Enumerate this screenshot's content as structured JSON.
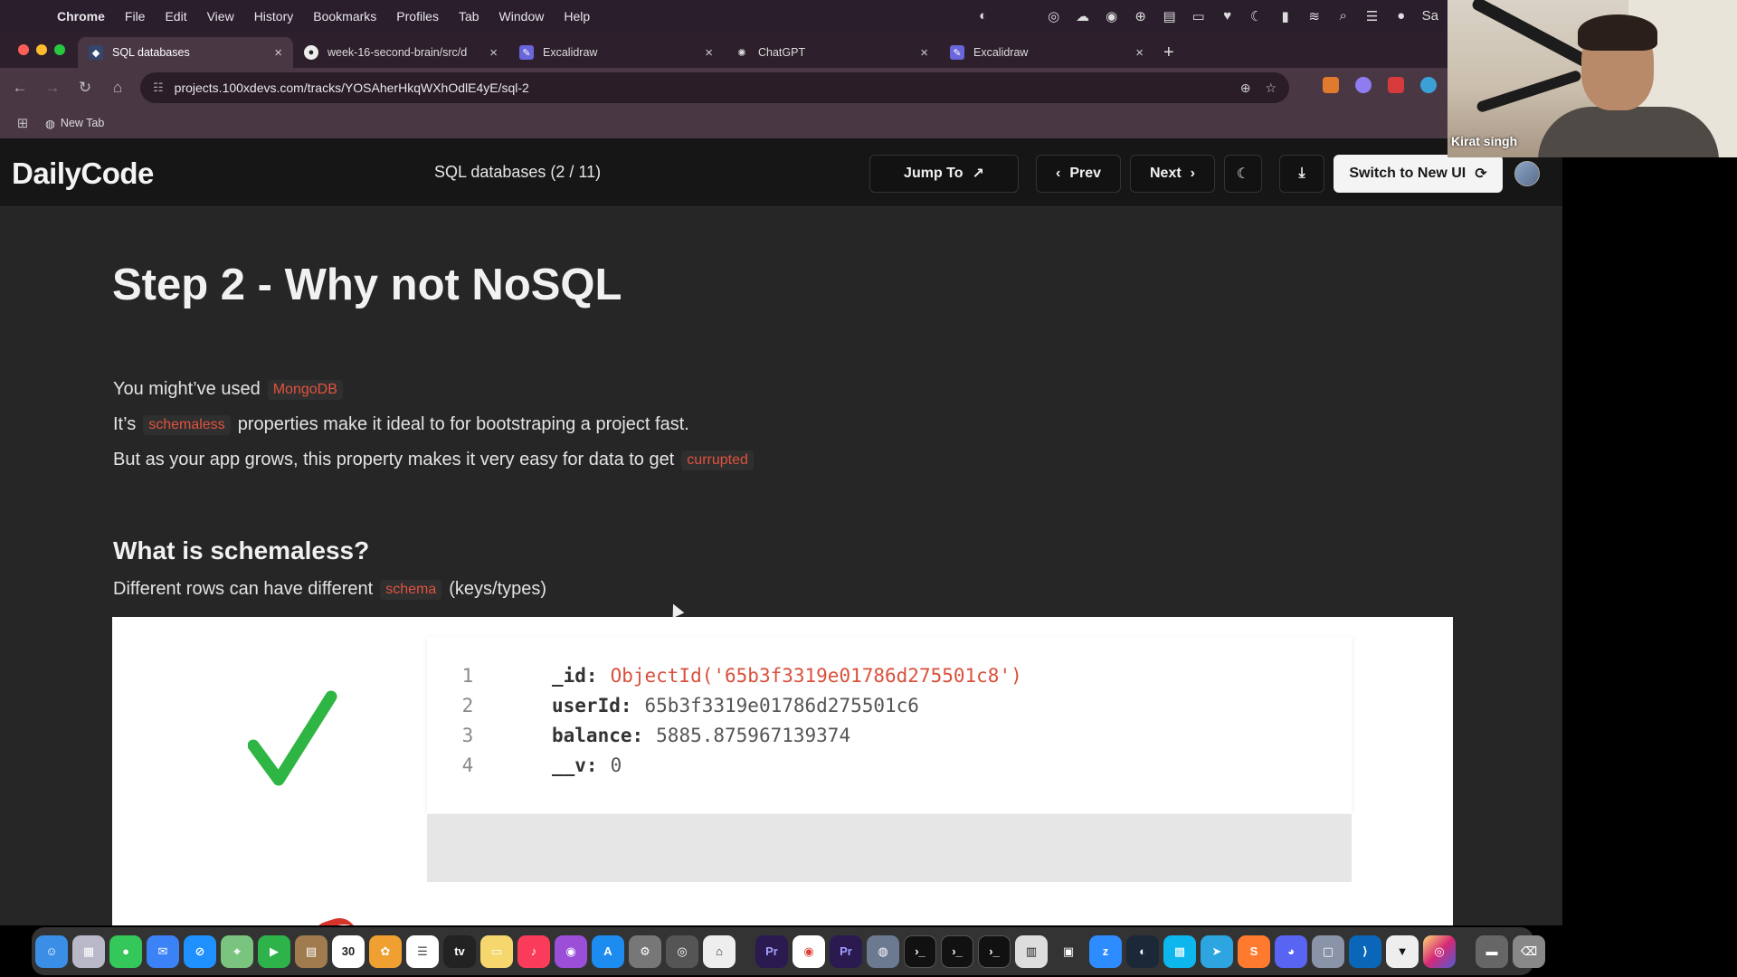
{
  "menubar": {
    "app_name": "Chrome",
    "items": [
      "File",
      "Edit",
      "View",
      "History",
      "Bookmarks",
      "Profiles",
      "Tab",
      "Window",
      "Help"
    ],
    "status_icons": [
      "sync-icon",
      "vpn-icon",
      "cloud-icon",
      "network-icon",
      "globe-icon",
      "clipboard-icon",
      "battery-sensor-icon",
      "heart-icon",
      "moon-icon",
      "battery-icon",
      "wifi-icon",
      "search-icon",
      "control-center-icon",
      "siri-icon"
    ],
    "trailing_text": "Sa"
  },
  "browser": {
    "tabs": [
      {
        "title": "SQL databases",
        "active": true,
        "favicon": "100x-icon"
      },
      {
        "title": "week-16-second-brain/src/d",
        "active": false,
        "favicon": "github-icon"
      },
      {
        "title": "Excalidraw",
        "active": false,
        "favicon": "excalidraw-icon"
      },
      {
        "title": "ChatGPT",
        "active": false,
        "favicon": "chatgpt-icon"
      },
      {
        "title": "Excalidraw",
        "active": false,
        "favicon": "excalidraw-icon"
      }
    ],
    "url": "projects.100xdevs.com/tracks/YOSAherHkqWXhOdlE4yE/sql-2",
    "bookmark": "New Tab"
  },
  "app": {
    "logo": "DailyCode",
    "course_title": "SQL databases (2 / 11)",
    "jump_to": "Jump To",
    "prev": "Prev",
    "next": "Next",
    "switch_ui": "Switch to New UI"
  },
  "content": {
    "heading": "Step 2 - Why not NoSQL",
    "line1_text": "You might’ve used",
    "line1_code": "MongoDB",
    "line2_pre": "It’s",
    "line2_code": "schemaless",
    "line2_post": "properties make it ideal to for bootstraping a project fast.",
    "line3_text": "But as your app grows, this property makes it very easy for data to get",
    "line3_code": "currupted",
    "subheading": "What is schemaless?",
    "line4_pre": "Different rows can have different",
    "line4_code": "schema",
    "line4_post": "(keys/types)"
  },
  "code_sample": {
    "lines": [
      {
        "n": "1",
        "key": "_id:",
        "value": "ObjectId('65b3f3319e01786d275501c8')"
      },
      {
        "n": "2",
        "key": "userId:",
        "value": "65b3f3319e01786d275501c6"
      },
      {
        "n": "3",
        "key": "balance:",
        "value": "5885.875967139374"
      },
      {
        "n": "4",
        "key": "__v:",
        "value": "0"
      }
    ]
  },
  "webcam": {
    "name": "Kirat singh"
  },
  "dock": {
    "calendar_day": "30",
    "apps": [
      "finder-icon",
      "launchpad-icon",
      "messages-icon",
      "mail-icon",
      "safari-icon",
      "maps-icon",
      "facetime-icon",
      "notes-icon",
      "calendar-icon",
      "photos-icon",
      "reminders-icon",
      "appletv-icon",
      "stickies-icon",
      "music-icon",
      "podcasts-icon",
      "appstore-icon",
      "settings-icon",
      "chrome-devtools-icon",
      "preview-icon",
      "premiere-icon",
      "chrome-icon",
      "premiere-icon-2",
      "proxyman-icon",
      "terminal-icon",
      "terminal-icon-2",
      "terminal-icon-3",
      "piano-icon",
      "monitor-icon",
      "zoom-icon",
      "steam-icon",
      "docker-icon",
      "telegram-icon",
      "sublime-icon",
      "discord-icon",
      "screen-icon",
      "vscode-icon",
      "cursor-icon",
      "instagram-icon",
      "archive-icon",
      "trash-icon"
    ]
  }
}
